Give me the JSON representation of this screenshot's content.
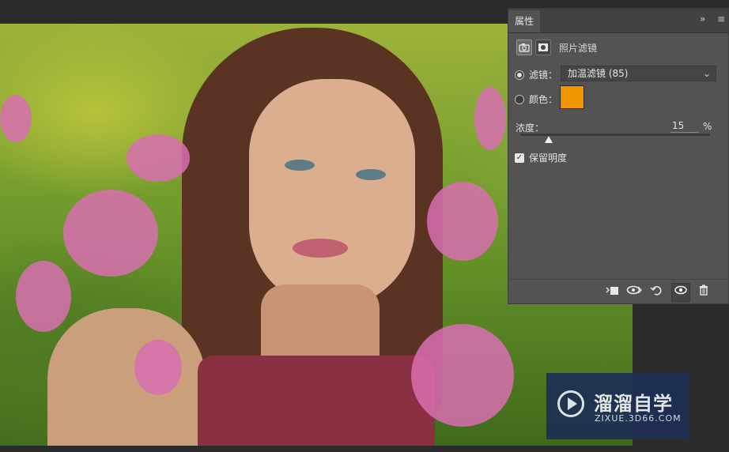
{
  "panel": {
    "tab_label": "属性",
    "collapse_glyph": "»",
    "menu_glyph": "≡",
    "layer_title": "照片滤镜",
    "filter": {
      "label": "滤镜：",
      "value": "加温滤镜 (85)",
      "selected": true
    },
    "color": {
      "label": "颜色：",
      "swatch": "#f09400",
      "selected": false
    },
    "density": {
      "label": "浓度：",
      "value": "15",
      "unit": "%",
      "level_percent": 15
    },
    "preserve": {
      "label": "保留明度",
      "checked": true
    }
  },
  "bottom_icons": [
    "clip-to-layer-icon",
    "view-previous-state-icon",
    "reset-icon",
    "visibility-eye-icon",
    "trash-icon"
  ],
  "watermark": {
    "title": "溜溜自学",
    "subtitle": "ZIXUE.3D66.COM"
  }
}
